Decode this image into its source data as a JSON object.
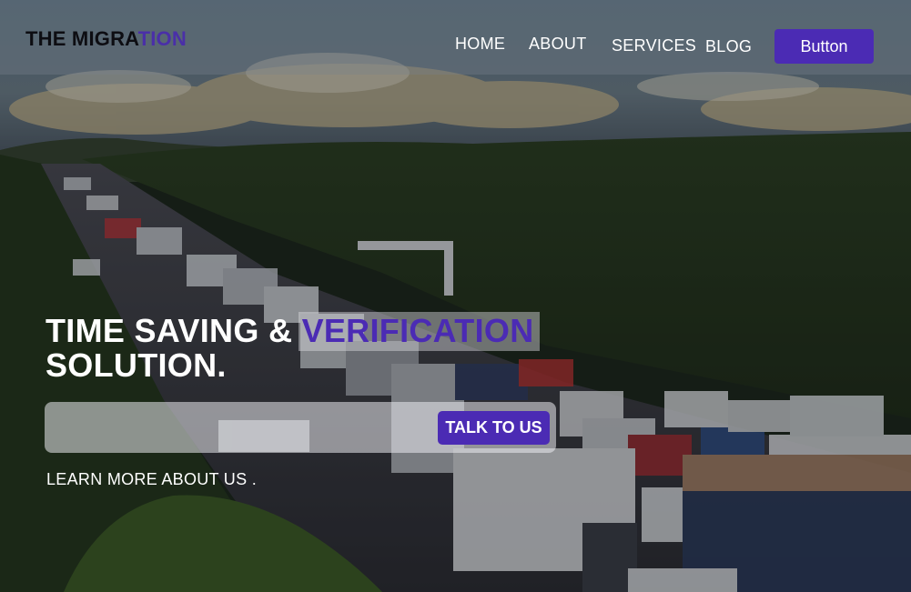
{
  "header": {
    "logo_main": "THE MIGRA",
    "logo_accent": "TION",
    "nav": [
      "HOME",
      "ABOUT",
      "SERVICES",
      "BLOG"
    ],
    "button_label": "Button"
  },
  "hero": {
    "title_line1_plain": "TIME SAVING & ",
    "title_line1_highlight": "VERIFICATION",
    "title_line2": "SOLUTION.",
    "cta_label": "TALK TO US",
    "learn_more": "LEARN MORE ABOUT US ."
  },
  "colors": {
    "accent": "#4b2bb4",
    "logo_text": "#0d0d12",
    "text": "#ffffff"
  },
  "background_image": "traffic-jam-highway-photo"
}
